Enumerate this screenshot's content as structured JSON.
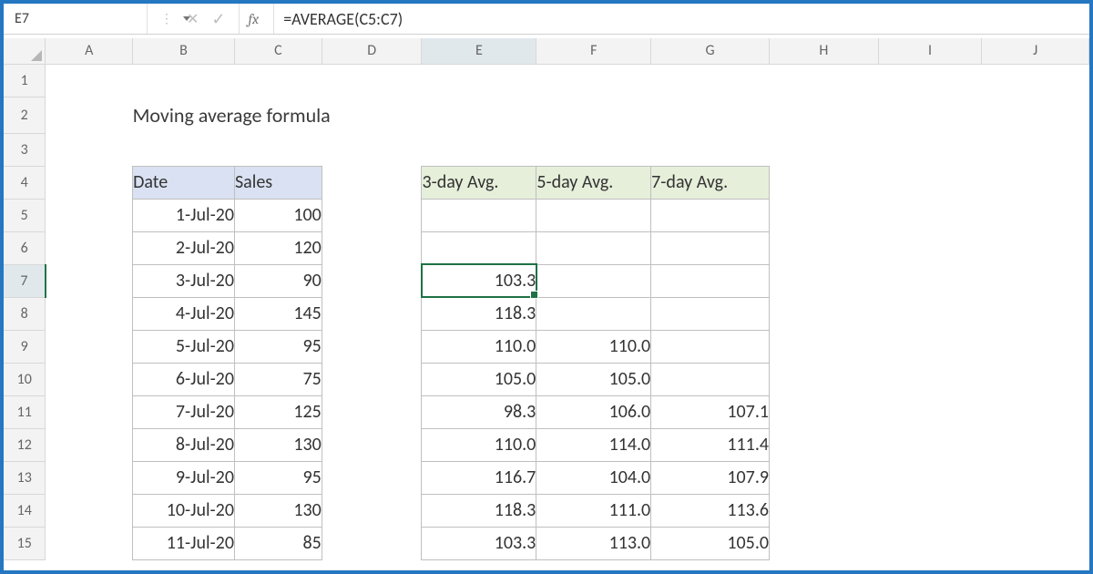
{
  "namebox": {
    "value": "E7"
  },
  "fx_label": "fx",
  "formula": "=AVERAGE(C5:C7)",
  "columns": [
    "A",
    "B",
    "C",
    "D",
    "E",
    "F",
    "G",
    "H",
    "I",
    "J"
  ],
  "row_numbers": [
    1,
    2,
    3,
    4,
    5,
    6,
    7,
    8,
    9,
    10,
    11,
    12,
    13,
    14,
    15
  ],
  "title": "Moving average formula",
  "headers": {
    "date": "Date",
    "sales": "Sales",
    "avg3": "3-day Avg.",
    "avg5": "5-day Avg.",
    "avg7": "7-day Avg."
  },
  "rows": [
    {
      "date": "1-Jul-20",
      "sales": "100",
      "a3": "",
      "a5": "",
      "a7": ""
    },
    {
      "date": "2-Jul-20",
      "sales": "120",
      "a3": "",
      "a5": "",
      "a7": ""
    },
    {
      "date": "3-Jul-20",
      "sales": "90",
      "a3": "103.3",
      "a5": "",
      "a7": ""
    },
    {
      "date": "4-Jul-20",
      "sales": "145",
      "a3": "118.3",
      "a5": "",
      "a7": ""
    },
    {
      "date": "5-Jul-20",
      "sales": "95",
      "a3": "110.0",
      "a5": "110.0",
      "a7": ""
    },
    {
      "date": "6-Jul-20",
      "sales": "75",
      "a3": "105.0",
      "a5": "105.0",
      "a7": ""
    },
    {
      "date": "7-Jul-20",
      "sales": "125",
      "a3": "98.3",
      "a5": "106.0",
      "a7": "107.1"
    },
    {
      "date": "8-Jul-20",
      "sales": "130",
      "a3": "110.0",
      "a5": "114.0",
      "a7": "111.4"
    },
    {
      "date": "9-Jul-20",
      "sales": "95",
      "a3": "116.7",
      "a5": "104.0",
      "a7": "107.9"
    },
    {
      "date": "10-Jul-20",
      "sales": "130",
      "a3": "118.3",
      "a5": "111.0",
      "a7": "113.6"
    },
    {
      "date": "11-Jul-20",
      "sales": "85",
      "a3": "103.3",
      "a5": "113.0",
      "a7": "105.0"
    }
  ],
  "active_cell": {
    "col": "E",
    "row": 7
  }
}
